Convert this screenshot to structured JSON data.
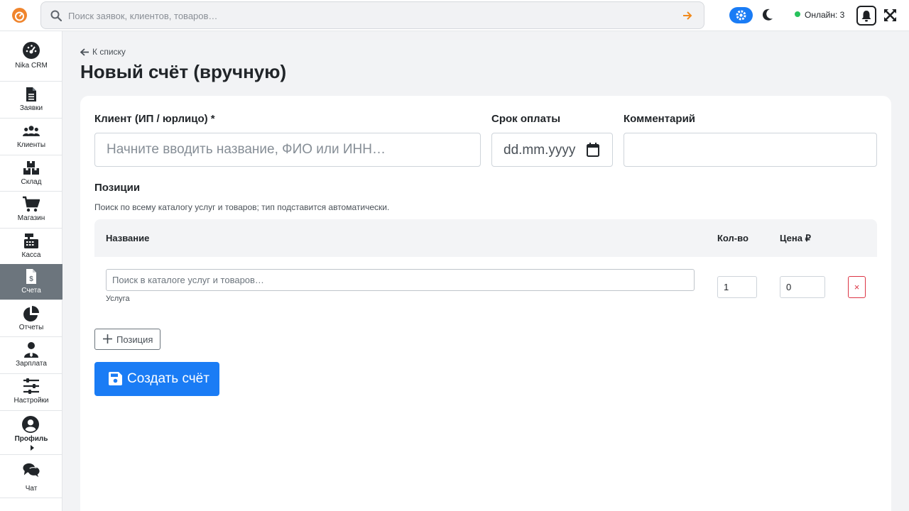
{
  "topbar": {
    "search_placeholder": "Поиск заявок, клиентов, товаров…",
    "online_label": "Онлайн: 3"
  },
  "sidebar": {
    "items": [
      {
        "label": "Nika CRM",
        "icon": "dashboard-gauge-icon"
      },
      {
        "label": "Заявки",
        "icon": "file-icon"
      },
      {
        "label": "Клиенты",
        "icon": "users-icon"
      },
      {
        "label": "Склад",
        "icon": "boxes-icon"
      },
      {
        "label": "Магазин",
        "icon": "cart-icon"
      },
      {
        "label": "Касса",
        "icon": "cash-register-icon"
      },
      {
        "label": "Счета",
        "icon": "invoice-icon",
        "active": true
      },
      {
        "label": "Отчеты",
        "icon": "pie-chart-icon"
      },
      {
        "label": "Зарплата",
        "icon": "user-tie-icon"
      },
      {
        "label": "Настройки",
        "icon": "sliders-icon"
      },
      {
        "label": "Профиль",
        "icon": "user-circle-icon"
      },
      {
        "label": "Чат",
        "icon": "comments-icon"
      }
    ]
  },
  "page": {
    "back_label": "К списку",
    "title": "Новый счёт (вручную)"
  },
  "form": {
    "client_label": "Клиент (ИП / юрлицо) *",
    "client_placeholder": "Начните вводить название, ФИО или ИНН…",
    "due_label": "Срок оплаты",
    "due_placeholder": "dd.mm.yyyy",
    "comment_label": "Комментарий",
    "comment_value": ""
  },
  "positions": {
    "title": "Позиции",
    "hint": "Поиск по всему каталогу услуг и товаров; тип подставится автоматически.",
    "columns": [
      "Название",
      "Кол-во",
      "Цена ₽"
    ],
    "rows": [
      {
        "search_placeholder": "Поиск в каталоге услуг и товаров…",
        "type": "Услуга",
        "qty": "1",
        "price": "0",
        "remove": "×"
      }
    ],
    "add_label": "Позиция"
  },
  "submit_label": "Создать счёт",
  "colors": {
    "accent": "#1a7cf5",
    "danger": "#dc3545",
    "online": "#27c25c",
    "logo": "#f0852d"
  }
}
